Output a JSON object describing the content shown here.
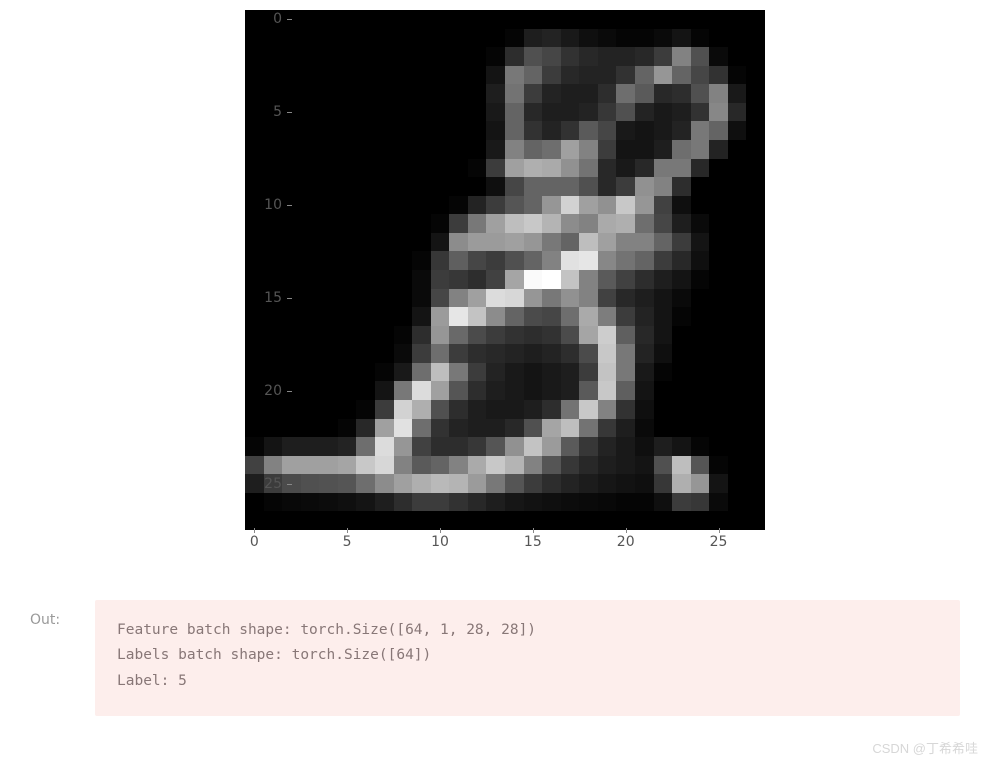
{
  "chart_data": {
    "type": "heatmap",
    "title": "",
    "xlabel": "",
    "ylabel": "",
    "x_ticks": [
      0,
      5,
      10,
      15,
      20,
      25
    ],
    "y_ticks": [
      0,
      5,
      10,
      15,
      20,
      25
    ],
    "rows": 28,
    "cols": 28,
    "colormap": "gray",
    "values": [
      [
        0,
        0,
        0,
        0,
        0,
        0,
        0,
        0,
        0,
        0,
        0,
        0,
        0,
        0,
        0,
        0,
        0,
        0,
        0,
        0,
        0,
        0,
        0,
        0,
        0,
        0,
        0,
        0
      ],
      [
        0,
        0,
        0,
        0,
        0,
        0,
        0,
        0,
        0,
        0,
        0,
        0,
        0,
        0,
        5,
        30,
        35,
        25,
        15,
        10,
        5,
        5,
        10,
        20,
        5,
        0,
        0,
        0
      ],
      [
        0,
        0,
        0,
        0,
        0,
        0,
        0,
        0,
        0,
        0,
        0,
        0,
        0,
        5,
        45,
        80,
        70,
        50,
        40,
        35,
        35,
        40,
        60,
        130,
        80,
        10,
        0,
        0
      ],
      [
        0,
        0,
        0,
        0,
        0,
        0,
        0,
        0,
        0,
        0,
        0,
        0,
        0,
        20,
        120,
        100,
        60,
        40,
        35,
        35,
        50,
        100,
        150,
        100,
        70,
        50,
        5,
        0
      ],
      [
        0,
        0,
        0,
        0,
        0,
        0,
        0,
        0,
        0,
        0,
        0,
        0,
        0,
        30,
        115,
        60,
        35,
        30,
        30,
        45,
        110,
        90,
        40,
        45,
        80,
        130,
        25,
        0
      ],
      [
        0,
        0,
        0,
        0,
        0,
        0,
        0,
        0,
        0,
        0,
        0,
        0,
        0,
        25,
        100,
        40,
        30,
        30,
        35,
        55,
        80,
        35,
        25,
        30,
        50,
        135,
        40,
        0
      ],
      [
        0,
        0,
        0,
        0,
        0,
        0,
        0,
        0,
        0,
        0,
        0,
        0,
        0,
        20,
        100,
        50,
        35,
        50,
        90,
        70,
        25,
        20,
        25,
        35,
        120,
        100,
        15,
        0
      ],
      [
        0,
        0,
        0,
        0,
        0,
        0,
        0,
        0,
        0,
        0,
        0,
        0,
        0,
        25,
        130,
        100,
        110,
        160,
        130,
        60,
        20,
        20,
        30,
        110,
        120,
        35,
        0,
        0
      ],
      [
        0,
        0,
        0,
        0,
        0,
        0,
        0,
        0,
        0,
        0,
        0,
        0,
        5,
        60,
        160,
        175,
        170,
        145,
        115,
        40,
        25,
        40,
        120,
        120,
        40,
        0,
        0,
        0
      ],
      [
        0,
        0,
        0,
        0,
        0,
        0,
        0,
        0,
        0,
        0,
        0,
        0,
        0,
        15,
        70,
        100,
        100,
        100,
        80,
        40,
        60,
        145,
        130,
        45,
        0,
        0,
        0,
        0
      ],
      [
        0,
        0,
        0,
        0,
        0,
        0,
        0,
        0,
        0,
        0,
        0,
        5,
        35,
        60,
        85,
        100,
        150,
        210,
        160,
        145,
        200,
        150,
        65,
        15,
        0,
        0,
        0,
        0
      ],
      [
        0,
        0,
        0,
        0,
        0,
        0,
        0,
        0,
        0,
        0,
        5,
        60,
        120,
        160,
        190,
        200,
        180,
        140,
        130,
        170,
        175,
        110,
        70,
        30,
        10,
        0,
        0,
        0
      ],
      [
        0,
        0,
        0,
        0,
        0,
        0,
        0,
        0,
        0,
        0,
        20,
        140,
        155,
        155,
        160,
        150,
        120,
        100,
        190,
        160,
        130,
        130,
        100,
        60,
        20,
        0,
        0,
        0
      ],
      [
        0,
        0,
        0,
        0,
        0,
        0,
        0,
        0,
        0,
        5,
        55,
        95,
        70,
        60,
        80,
        100,
        130,
        225,
        230,
        135,
        115,
        100,
        60,
        40,
        15,
        0,
        0,
        0
      ],
      [
        0,
        0,
        0,
        0,
        0,
        0,
        0,
        0,
        0,
        10,
        60,
        55,
        45,
        65,
        165,
        250,
        255,
        195,
        130,
        90,
        65,
        45,
        30,
        20,
        5,
        0,
        0,
        0
      ],
      [
        0,
        0,
        0,
        0,
        0,
        0,
        0,
        0,
        0,
        10,
        70,
        130,
        160,
        220,
        215,
        150,
        120,
        145,
        130,
        65,
        40,
        30,
        20,
        10,
        0,
        0,
        0,
        0
      ],
      [
        0,
        0,
        0,
        0,
        0,
        0,
        0,
        0,
        0,
        20,
        155,
        230,
        195,
        140,
        100,
        75,
        70,
        110,
        170,
        125,
        60,
        35,
        20,
        5,
        0,
        0,
        0,
        0
      ],
      [
        0,
        0,
        0,
        0,
        0,
        0,
        0,
        0,
        5,
        45,
        150,
        105,
        75,
        60,
        50,
        45,
        50,
        75,
        165,
        205,
        95,
        40,
        20,
        0,
        0,
        0,
        0,
        0
      ],
      [
        0,
        0,
        0,
        0,
        0,
        0,
        0,
        0,
        10,
        60,
        110,
        60,
        45,
        40,
        35,
        30,
        35,
        45,
        75,
        200,
        120,
        35,
        15,
        0,
        0,
        0,
        0,
        0
      ],
      [
        0,
        0,
        0,
        0,
        0,
        0,
        0,
        5,
        25,
        110,
        190,
        120,
        60,
        35,
        25,
        20,
        25,
        30,
        60,
        195,
        120,
        25,
        5,
        0,
        0,
        0,
        0,
        0
      ],
      [
        0,
        0,
        0,
        0,
        0,
        0,
        0,
        20,
        120,
        220,
        160,
        85,
        45,
        30,
        25,
        20,
        25,
        30,
        90,
        200,
        95,
        20,
        0,
        0,
        0,
        0,
        0,
        0
      ],
      [
        0,
        0,
        0,
        0,
        0,
        0,
        5,
        60,
        210,
        175,
        80,
        45,
        30,
        25,
        25,
        30,
        45,
        115,
        200,
        130,
        50,
        15,
        0,
        0,
        0,
        0,
        0,
        0
      ],
      [
        0,
        0,
        0,
        0,
        0,
        5,
        40,
        160,
        225,
        110,
        50,
        35,
        30,
        30,
        40,
        80,
        165,
        190,
        115,
        55,
        30,
        10,
        0,
        0,
        0,
        0,
        0,
        0
      ],
      [
        5,
        20,
        30,
        30,
        30,
        35,
        110,
        220,
        150,
        65,
        45,
        45,
        55,
        85,
        145,
        195,
        155,
        90,
        55,
        35,
        25,
        15,
        30,
        20,
        5,
        0,
        0,
        0
      ],
      [
        65,
        130,
        160,
        160,
        160,
        165,
        200,
        215,
        130,
        90,
        100,
        130,
        170,
        200,
        180,
        130,
        85,
        55,
        40,
        30,
        25,
        20,
        80,
        190,
        85,
        5,
        0,
        0
      ],
      [
        30,
        60,
        75,
        80,
        82,
        85,
        110,
        140,
        160,
        175,
        185,
        180,
        155,
        120,
        85,
        60,
        45,
        35,
        28,
        22,
        18,
        15,
        55,
        175,
        150,
        20,
        0,
        0
      ],
      [
        0,
        5,
        8,
        10,
        12,
        15,
        20,
        30,
        45,
        60,
        60,
        50,
        40,
        30,
        22,
        18,
        15,
        12,
        10,
        8,
        5,
        5,
        15,
        60,
        55,
        10,
        0,
        0
      ],
      [
        0,
        0,
        0,
        0,
        0,
        0,
        0,
        0,
        0,
        0,
        0,
        0,
        0,
        0,
        0,
        0,
        0,
        0,
        0,
        0,
        0,
        0,
        0,
        0,
        0,
        0,
        0,
        0
      ]
    ]
  },
  "output": {
    "label": "Out:",
    "lines": [
      "Feature batch shape: torch.Size([64, 1, 28, 28])",
      "Labels batch shape: torch.Size([64])",
      "Label: 5"
    ]
  },
  "watermark": "CSDN @丁希希哇"
}
